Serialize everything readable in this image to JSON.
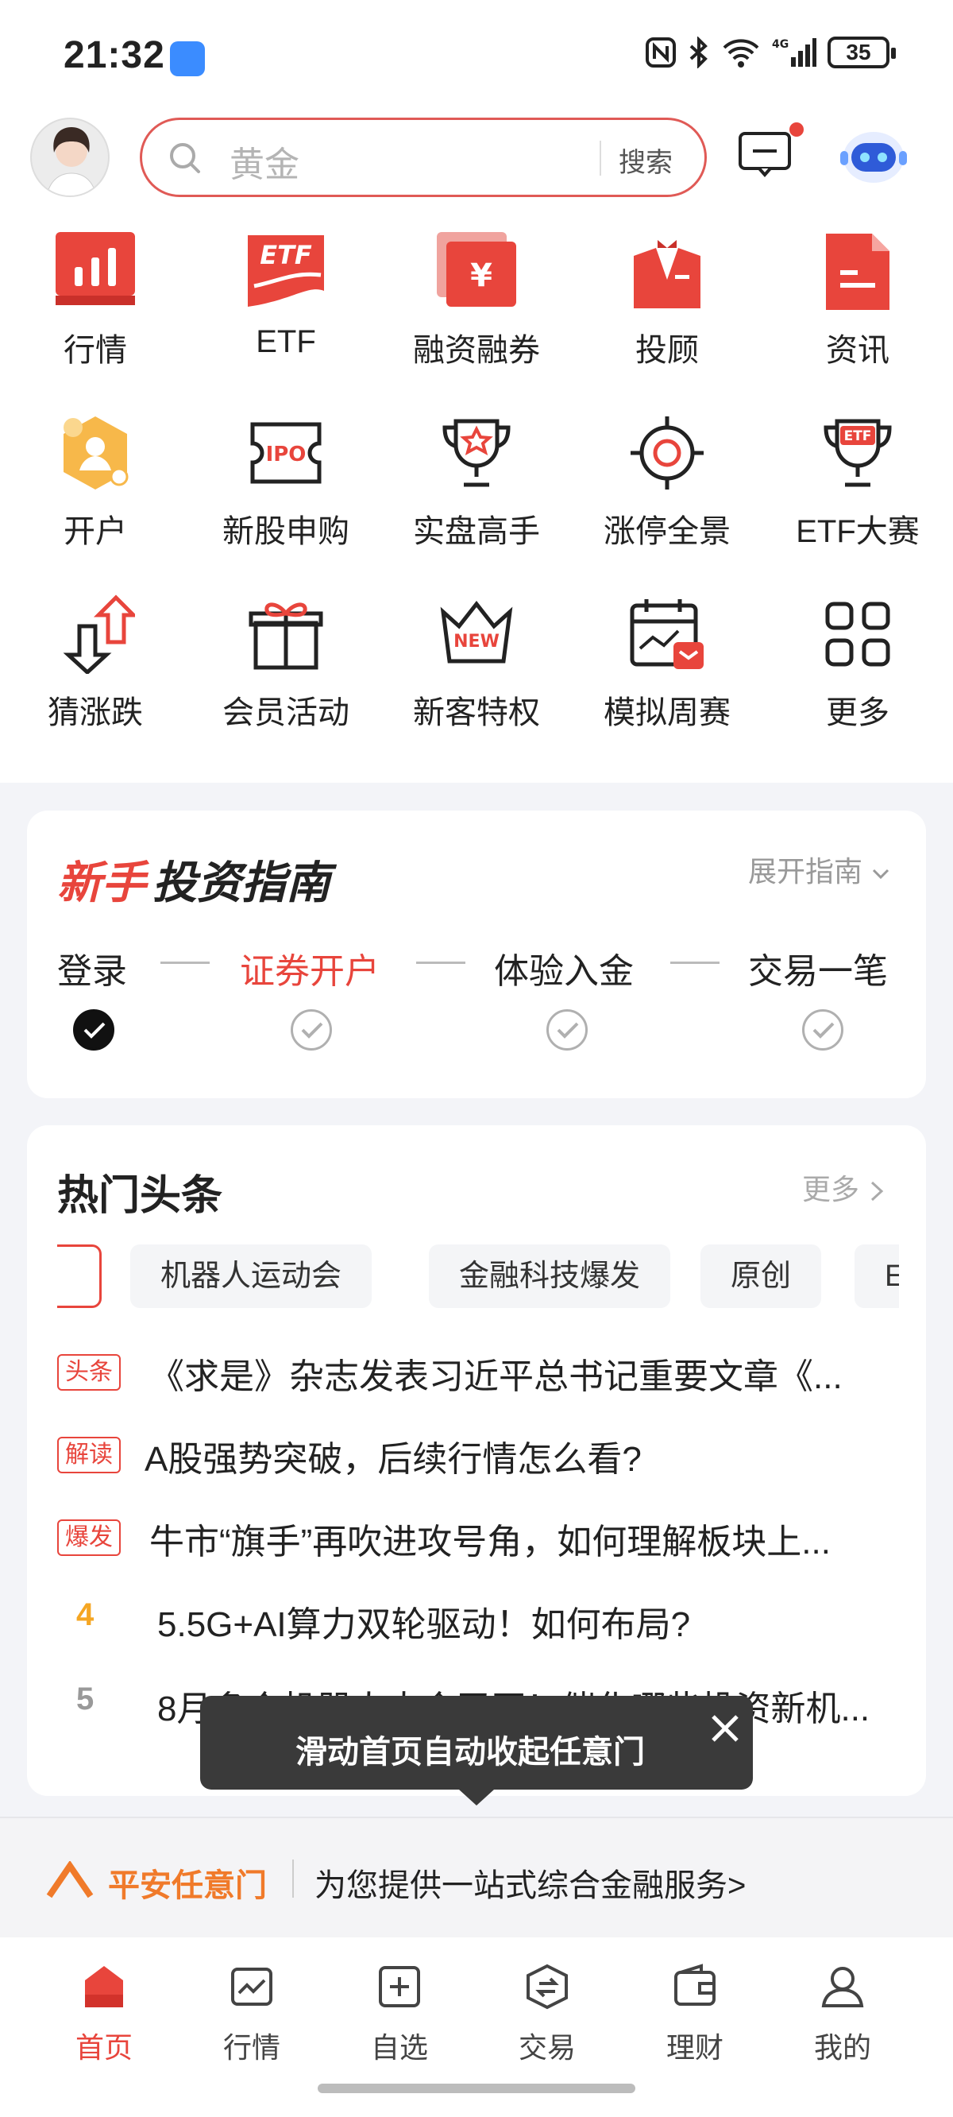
{
  "status_bar": {
    "time": "21:32",
    "battery": "35"
  },
  "header": {
    "search_placeholder": "黄金",
    "search_button": "搜索"
  },
  "grid": [
    {
      "label": "行情",
      "icon": "market-chart-icon"
    },
    {
      "label": "ETF",
      "icon": "etf-icon"
    },
    {
      "label": "融资融券",
      "icon": "margin-trading-icon"
    },
    {
      "label": "投顾",
      "icon": "advisor-icon"
    },
    {
      "label": "资讯",
      "icon": "news-doc-icon"
    },
    {
      "label": "开户",
      "icon": "open-account-icon"
    },
    {
      "label": "新股申购",
      "icon": "ipo-icon"
    },
    {
      "label": "实盘高手",
      "icon": "trophy-star-icon"
    },
    {
      "label": "涨停全景",
      "icon": "target-icon"
    },
    {
      "label": "ETF大赛",
      "icon": "etf-trophy-icon"
    },
    {
      "label": "猜涨跌",
      "icon": "up-down-arrows-icon"
    },
    {
      "label": "会员活动",
      "icon": "gift-icon"
    },
    {
      "label": "新客特权",
      "icon": "new-crown-icon"
    },
    {
      "label": "模拟周赛",
      "icon": "calendar-chart-icon"
    },
    {
      "label": "更多",
      "icon": "more-grid-icon"
    }
  ],
  "guide": {
    "title_red": "新手",
    "title_black": "投资指南",
    "expand": "展开指南",
    "steps": [
      "登录",
      "证券开户",
      "体验入金",
      "交易一笔"
    ]
  },
  "news": {
    "title": "热门头条",
    "more": "更多",
    "tags": [
      "机器人运动会",
      "金融科技爆发",
      "原创",
      "ET"
    ],
    "items": [
      {
        "badge": "头条",
        "text": "《求是》杂志发表习近平总书记重要文章《..."
      },
      {
        "badge": "解读",
        "text": "A股强势突破，后续行情怎么看?"
      },
      {
        "badge": "爆发",
        "text": "牛市“旗手”再吹进攻号角，如何理解板块上..."
      },
      {
        "num": "4",
        "text": "5.5G+AI算力双轮驱动！如何布局?"
      },
      {
        "num": "5",
        "text": "8月多个机器人大会召开！催化哪些投资新机..."
      }
    ]
  },
  "tooltip": {
    "text": "滑动首页自动收起任意门"
  },
  "banner": {
    "brand": "平安任意门",
    "slogan": "为您提供一站式综合金融服务>"
  },
  "tabbar": [
    "首页",
    "行情",
    "自选",
    "交易",
    "理财",
    "我的"
  ],
  "colors": {
    "accent": "#e8453c",
    "orange": "#f07a2a"
  }
}
